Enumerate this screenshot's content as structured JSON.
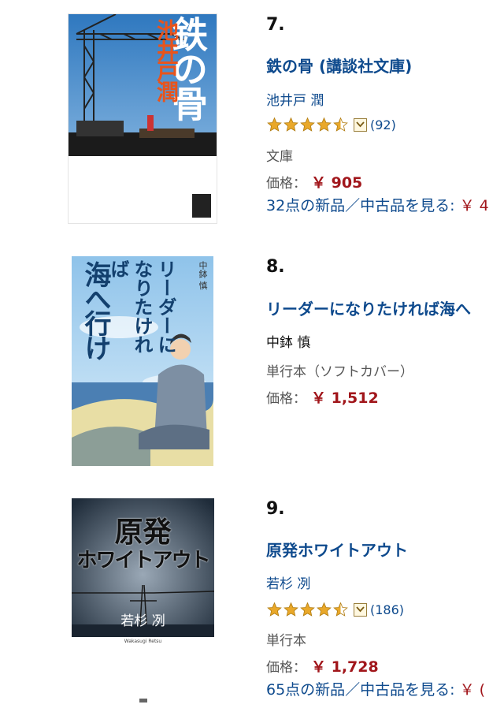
{
  "colors": {
    "link": "#0e4a8d",
    "price": "#a1161b",
    "star": "#e9a82a"
  },
  "items": [
    {
      "rank": "7.",
      "title": "鉄の骨 (講談社文庫)",
      "author": "池井戸 潤",
      "rating": 4.5,
      "review_count": "(92)",
      "format": "文庫",
      "price_label": "価格：",
      "price": "￥ 905",
      "offers": "32点の新品／中古品を見る:",
      "offers_more": "￥ 4",
      "cover": {
        "title_big": "鉄の骨",
        "author_vertical": "池井戸潤",
        "icon": "construction-crane-cover-image"
      }
    },
    {
      "rank": "8.",
      "title": "リーダーになりたければ海へ",
      "author": "中鉢 慎",
      "format": "単行本（ソフトカバー）",
      "price_label": "価格：",
      "price": "￥ 1,512",
      "cover": {
        "title_left": "海へ行け",
        "title_right": "リーダーになりたければ",
        "author": "中鉢 慎",
        "icon": "man-by-sea-cover-image"
      }
    },
    {
      "rank": "9.",
      "title": "原発ホワイトアウト",
      "author": "若杉 冽",
      "rating": 4.5,
      "review_count": "(186)",
      "format": "単行本",
      "price_label": "価格：",
      "price": "￥ 1,728",
      "offers": "65点の新品／中古品を見る:",
      "offers_more": "￥ (",
      "cover": {
        "line1": "原発",
        "line2": "ホワイトアウト",
        "author": "若杉 冽",
        "romaji": "Wakasugi Retsu",
        "icon": "power-tower-cover-image"
      }
    }
  ]
}
